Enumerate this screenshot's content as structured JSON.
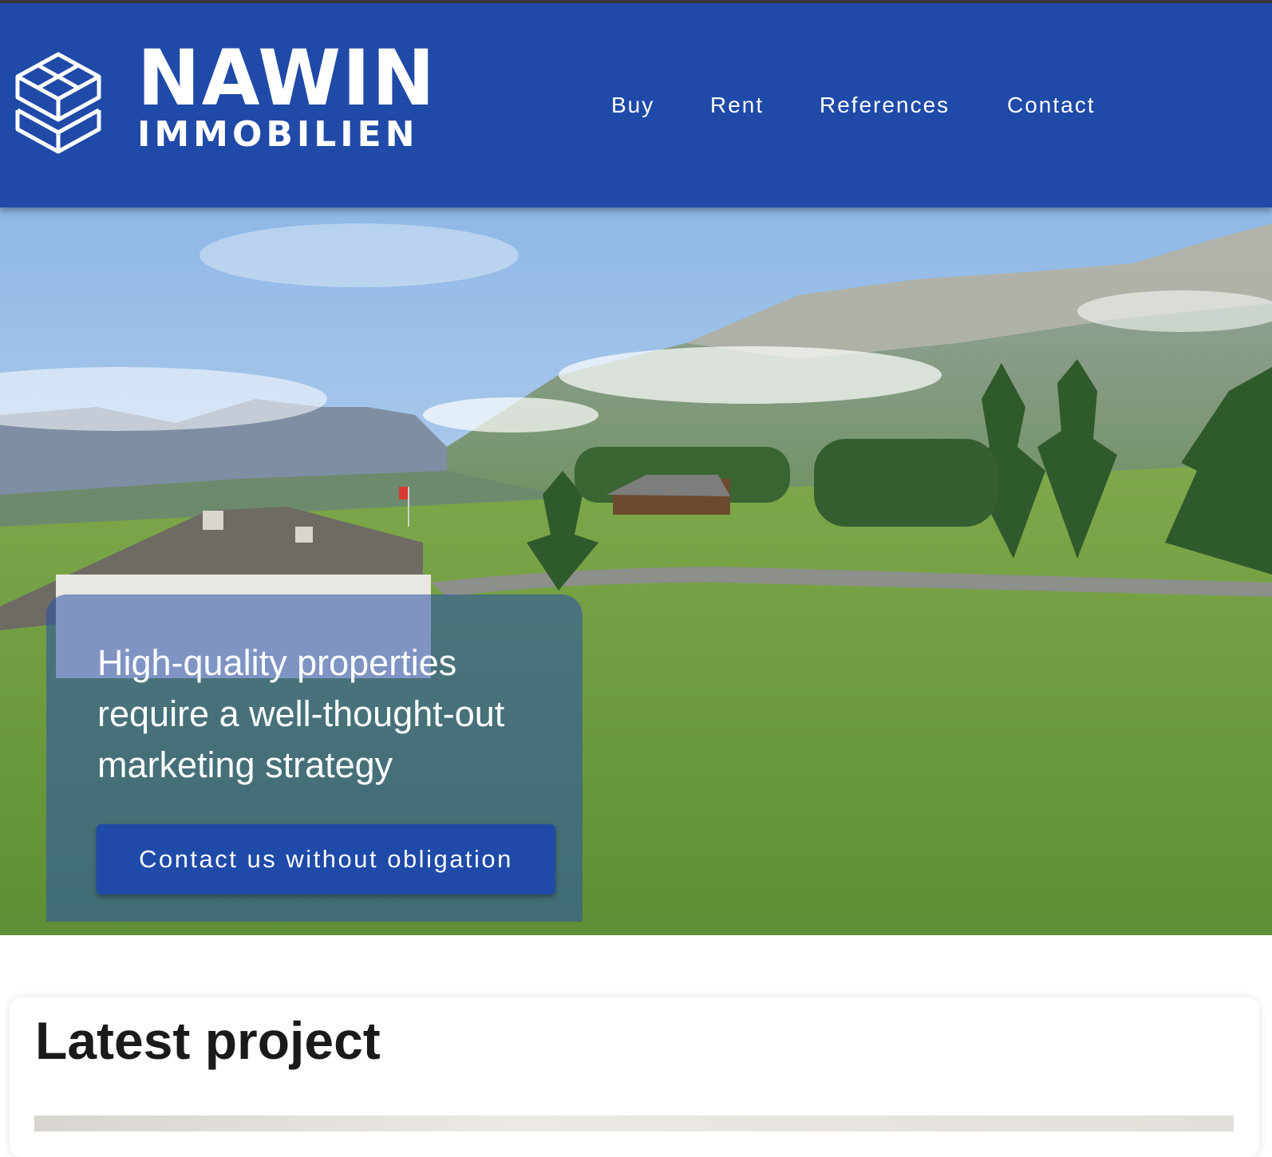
{
  "brand": {
    "name": "NAWIN",
    "subtitle": "IMMOBILIEN",
    "color": "#1f4aa8"
  },
  "nav": {
    "items": [
      {
        "label": "Buy"
      },
      {
        "label": "Rent"
      },
      {
        "label": "References"
      },
      {
        "label": "Contact"
      }
    ]
  },
  "hero": {
    "title": "High-quality properties require a well-thought-out marketing strategy",
    "cta_label": "Contact us without obligation"
  },
  "latest": {
    "heading": "Latest project"
  }
}
